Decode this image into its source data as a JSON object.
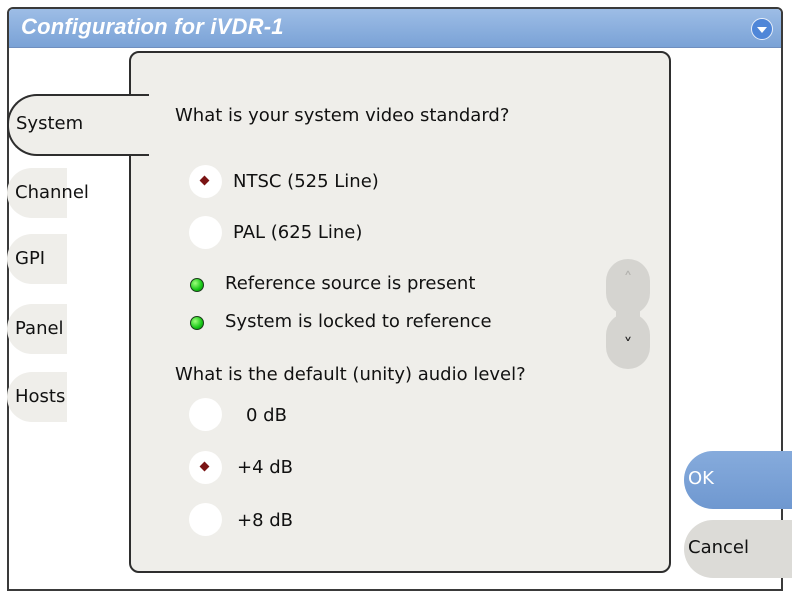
{
  "window": {
    "title": "Configuration for iVDR-1"
  },
  "tabs": [
    {
      "label": "System",
      "active": true
    },
    {
      "label": "Channel",
      "active": false
    },
    {
      "label": "GPI",
      "active": false
    },
    {
      "label": "Panel",
      "active": false
    },
    {
      "label": "Hosts",
      "active": false
    }
  ],
  "video_standard": {
    "question": "What is your system video standard?",
    "options": [
      {
        "label": "NTSC (525 Line)",
        "selected": true
      },
      {
        "label": "PAL (625 Line)",
        "selected": false
      }
    ]
  },
  "status": [
    {
      "label": "Reference source is present",
      "color": "#17c617"
    },
    {
      "label": "System is locked to reference",
      "color": "#17c617"
    }
  ],
  "audio_level": {
    "question": "What is the default (unity) audio level?",
    "options": [
      {
        "label": "0 dB",
        "selected": false
      },
      {
        "label": "+4 dB",
        "selected": true
      },
      {
        "label": "+8 dB",
        "selected": false
      }
    ]
  },
  "scroll": {
    "up_icon": "chevron-up-icon",
    "down_icon": "chevron-down-icon",
    "up_glyph": "˄",
    "down_glyph": "˅"
  },
  "buttons": {
    "ok": "OK",
    "cancel": "Cancel"
  },
  "colors": {
    "title_bar": "#7aa2d6",
    "selected_marker": "#7a1414",
    "led_on": "#17c617"
  }
}
